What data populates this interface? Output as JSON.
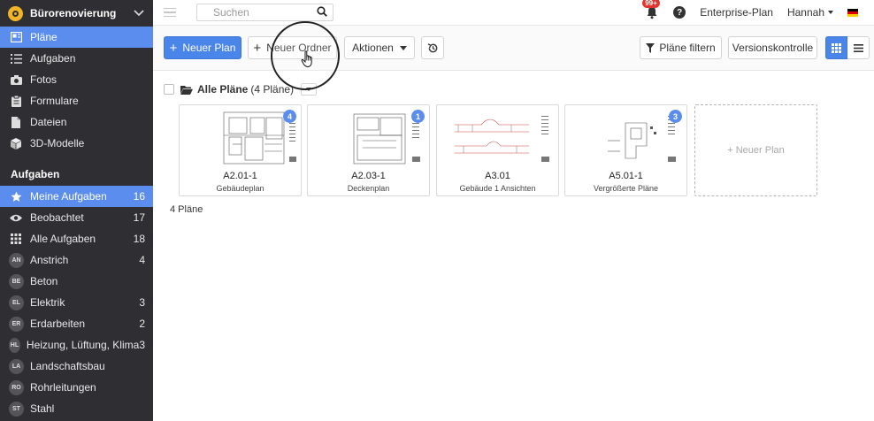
{
  "sidebar": {
    "project_name": "Bürorenovierung",
    "nav": [
      {
        "label": "Pläne",
        "icon": "plans-icon",
        "active": true
      },
      {
        "label": "Aufgaben",
        "icon": "list-icon"
      },
      {
        "label": "Fotos",
        "icon": "camera-icon"
      },
      {
        "label": "Formulare",
        "icon": "forms-icon"
      },
      {
        "label": "Dateien",
        "icon": "file-icon"
      },
      {
        "label": "3D-Modelle",
        "icon": "cube-icon"
      }
    ],
    "tasks_section_title": "Aufgaben",
    "tasks": [
      {
        "label": "Meine Aufgaben",
        "count": "16",
        "icon": "star-icon",
        "active": true
      },
      {
        "label": "Beobachtet",
        "count": "17",
        "icon": "eye-icon"
      },
      {
        "label": "Alle Aufgaben",
        "count": "18",
        "icon": "grid-icon"
      },
      {
        "badge": "AN",
        "label": "Anstrich",
        "count": "4"
      },
      {
        "badge": "BE",
        "label": "Beton",
        "count": ""
      },
      {
        "badge": "EL",
        "label": "Elektrik",
        "count": "3"
      },
      {
        "badge": "ER",
        "label": "Erdarbeiten",
        "count": "2"
      },
      {
        "badge": "HL",
        "label": "Heizung, Lüftung, Klima",
        "count": "3"
      },
      {
        "badge": "LA",
        "label": "Landschaftsbau",
        "count": ""
      },
      {
        "badge": "RO",
        "label": "Rohrleitungen",
        "count": ""
      },
      {
        "badge": "ST",
        "label": "Stahl",
        "count": ""
      }
    ]
  },
  "topbar": {
    "search_placeholder": "Suchen",
    "notifications_badge": "99+",
    "help_label": "?",
    "plan_label": "Enterprise-Plan",
    "user_name": "Hannah",
    "language_flag": "flag-de-icon"
  },
  "toolbar": {
    "new_plan": "Neuer Plan",
    "new_folder": "Neuer Ordner",
    "actions": "Aktionen",
    "filter": "Pläne filtern",
    "version_control": "Versionskontrolle"
  },
  "folder": {
    "title": "Alle Pläne",
    "count_label": "(4 Pläne)"
  },
  "plans": [
    {
      "title": "A2.01-1",
      "subtitle": "Gebäudeplan",
      "badge": "4"
    },
    {
      "title": "A2.03-1",
      "subtitle": "Deckenplan",
      "badge": "1"
    },
    {
      "title": "A3.01",
      "subtitle": "Gebäude 1 Ansichten",
      "badge": ""
    },
    {
      "title": "A5.01-1",
      "subtitle": "Vergrößerte Pläne",
      "badge": "3"
    }
  ],
  "new_plan_card": "+ Neuer Plan",
  "total_label": "4 Pläne",
  "colors": {
    "sidebar_bg": "#2f2f33",
    "accent": "#4a85ea",
    "active_item": "#5b8def",
    "notification": "#e4342e",
    "logo": "#f0b429"
  }
}
